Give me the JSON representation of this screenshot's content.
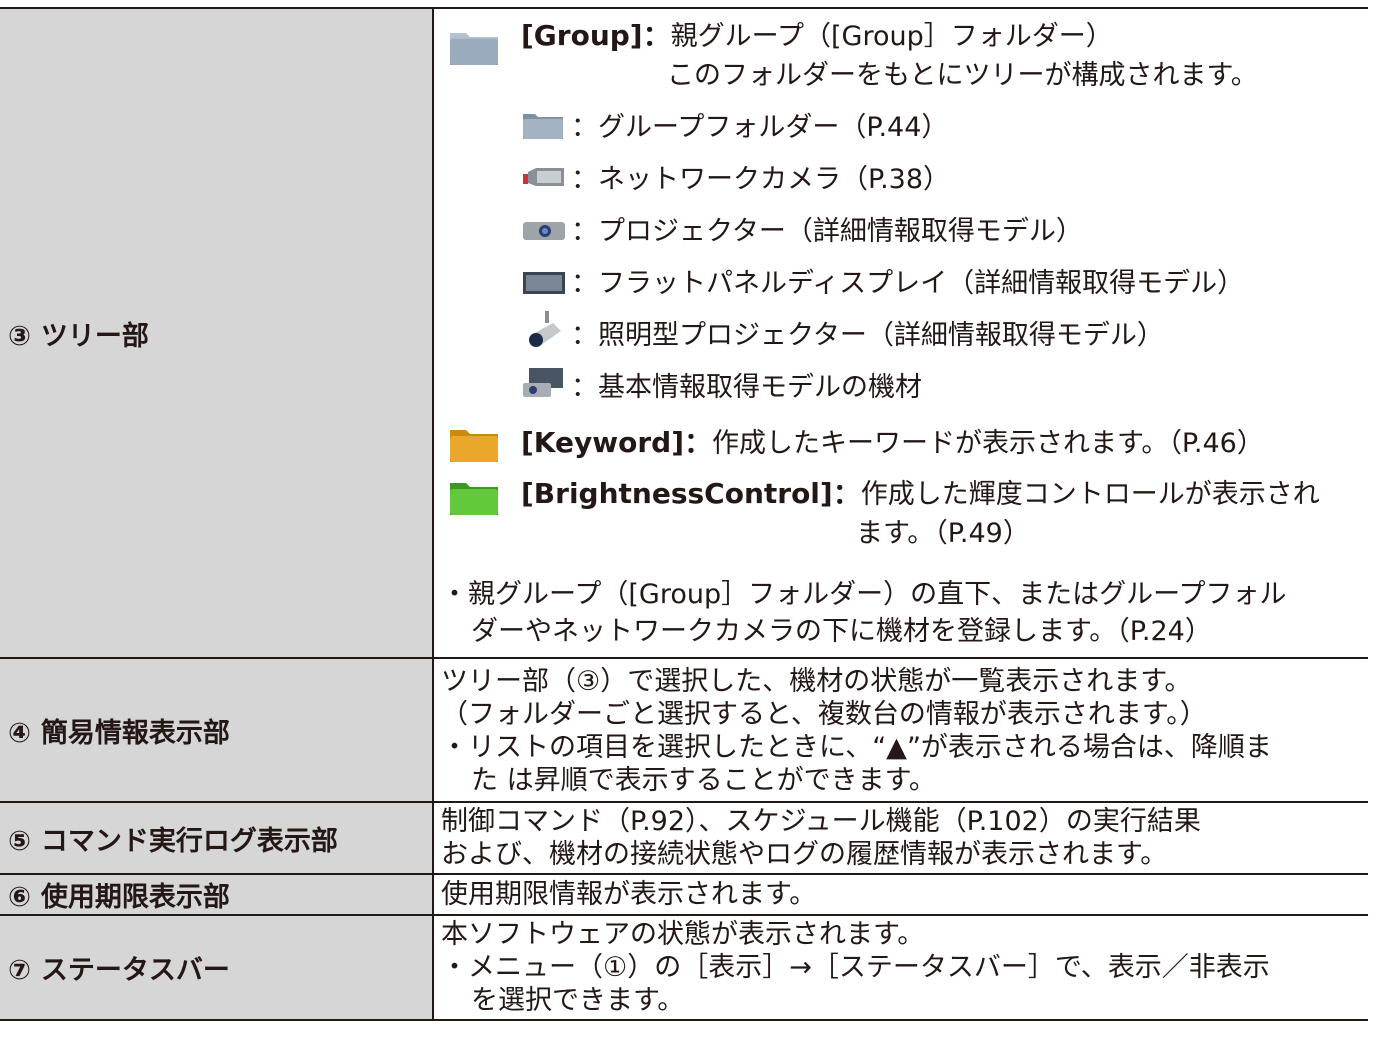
{
  "rows": [
    {
      "num": "③",
      "label": "ツリー部",
      "tree": {
        "group": {
          "key": "[Group]",
          "sep": "：",
          "text1": "親グループ（[Group］フォルダー）",
          "text2": "このフォルダーをもとにツリーが構成されます。"
        },
        "items": [
          {
            "icon": "group-folder-icon",
            "text": "：グループフォルダー（P.44）"
          },
          {
            "icon": "network-camera-icon",
            "text": "：ネットワークカメラ（P.38）"
          },
          {
            "icon": "projector-icon",
            "text": "：プロジェクター（詳細情報取得モデル）"
          },
          {
            "icon": "flat-panel-display-icon",
            "text": "：フラットパネルディスプレイ（詳細情報取得モデル）"
          },
          {
            "icon": "lighting-projector-icon",
            "text": "：照明型プロジェクター（詳細情報取得モデル）"
          },
          {
            "icon": "basic-equipment-icon",
            "text": "：基本情報取得モデルの機材"
          }
        ],
        "keyword": {
          "key": "[Keyword]",
          "sep": "：",
          "text": "作成したキーワードが表示されます。（P.46）"
        },
        "brightness": {
          "key": "[BrightnessControl]",
          "sep": "：",
          "text1": "作成した輝度コントロールが表示され",
          "text2": "ます。（P.49）"
        },
        "note1": "・親グループ（[Group］フォルダー）の直下、またはグループフォル",
        "note2": "ダーやネットワークカメラの下に機材を登録します。（P.24）"
      }
    },
    {
      "num": "④",
      "label": "簡易情報表示部",
      "lines": [
        "ツリー部（③）で選択した、機材の状態が一覧表示されます。",
        "（フォルダーごと選択すると、複数台の情報が表示されます。）",
        "・リストの項目を選択したときに、“▲”が表示される場合は、降順ま",
        "た は昇順で表示することができます。"
      ]
    },
    {
      "num": "⑤",
      "label": "コマンド実行ログ表示部",
      "lines": [
        "制御コマンド（P.92）、スケジュール機能（P.102）の実行結果",
        "および、機材の接続状態やログの履歴情報が表示されます。"
      ]
    },
    {
      "num": "⑥",
      "label": "使用期限表示部",
      "lines": [
        "使用期限情報が表示されます。"
      ]
    },
    {
      "num": "⑦",
      "label": "ステータスバー",
      "lines": [
        "本ソフトウェアの状態が表示されます。",
        "・メニュー（①）の［表示］→［ステータスバー］で、表示／非表示",
        "を選択できます。"
      ]
    }
  ],
  "colors": {
    "label_bg": "#d6d6d6",
    "border": "#231815",
    "group_folder": "#8fa1b3",
    "keyword_folder": "#e0a020",
    "brightness_folder": "#5ec23a"
  }
}
